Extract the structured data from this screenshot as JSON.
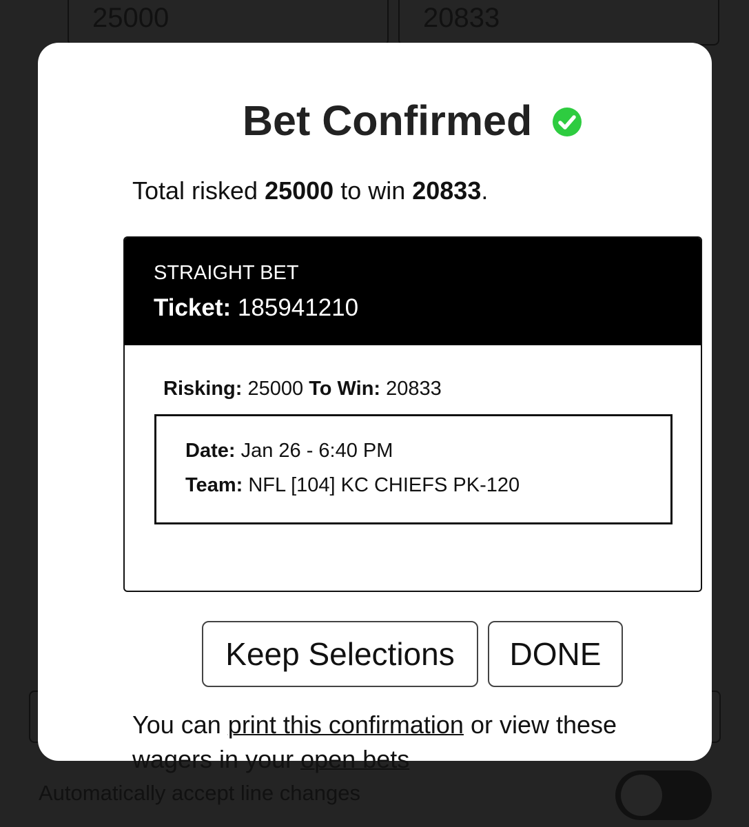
{
  "background": {
    "risk_input_value": "25000",
    "win_input_value": "20833",
    "auto_accept_label": "Automatically accept line changes",
    "auto_accept_enabled": false
  },
  "modal": {
    "title": "Bet Confirmed",
    "status_icon": "check-circle-icon",
    "status_color": "#2ecc40",
    "summary": {
      "prefix": "Total risked ",
      "risked": "25000",
      "middle": " to win ",
      "to_win": "20833",
      "suffix": "."
    },
    "ticket": {
      "bet_type": "STRAIGHT BET",
      "ticket_label": "Ticket:",
      "ticket_number": "185941210",
      "risking_label": "Risking:",
      "risking_value": "25000",
      "to_win_label": "To Win:",
      "to_win_value": "20833",
      "date_label": "Date:",
      "date_value": "Jan 26 - 6:40 PM",
      "team_label": "Team:",
      "team_value": "NFL [104] KC CHIEFS PK-120"
    },
    "buttons": {
      "keep_selections": "Keep Selections",
      "done": "DONE"
    },
    "footer": {
      "text_1": "You can ",
      "print_link": "print this confirmation",
      "text_2": " or view these wagers in your ",
      "open_bets_link": "open bets"
    }
  }
}
